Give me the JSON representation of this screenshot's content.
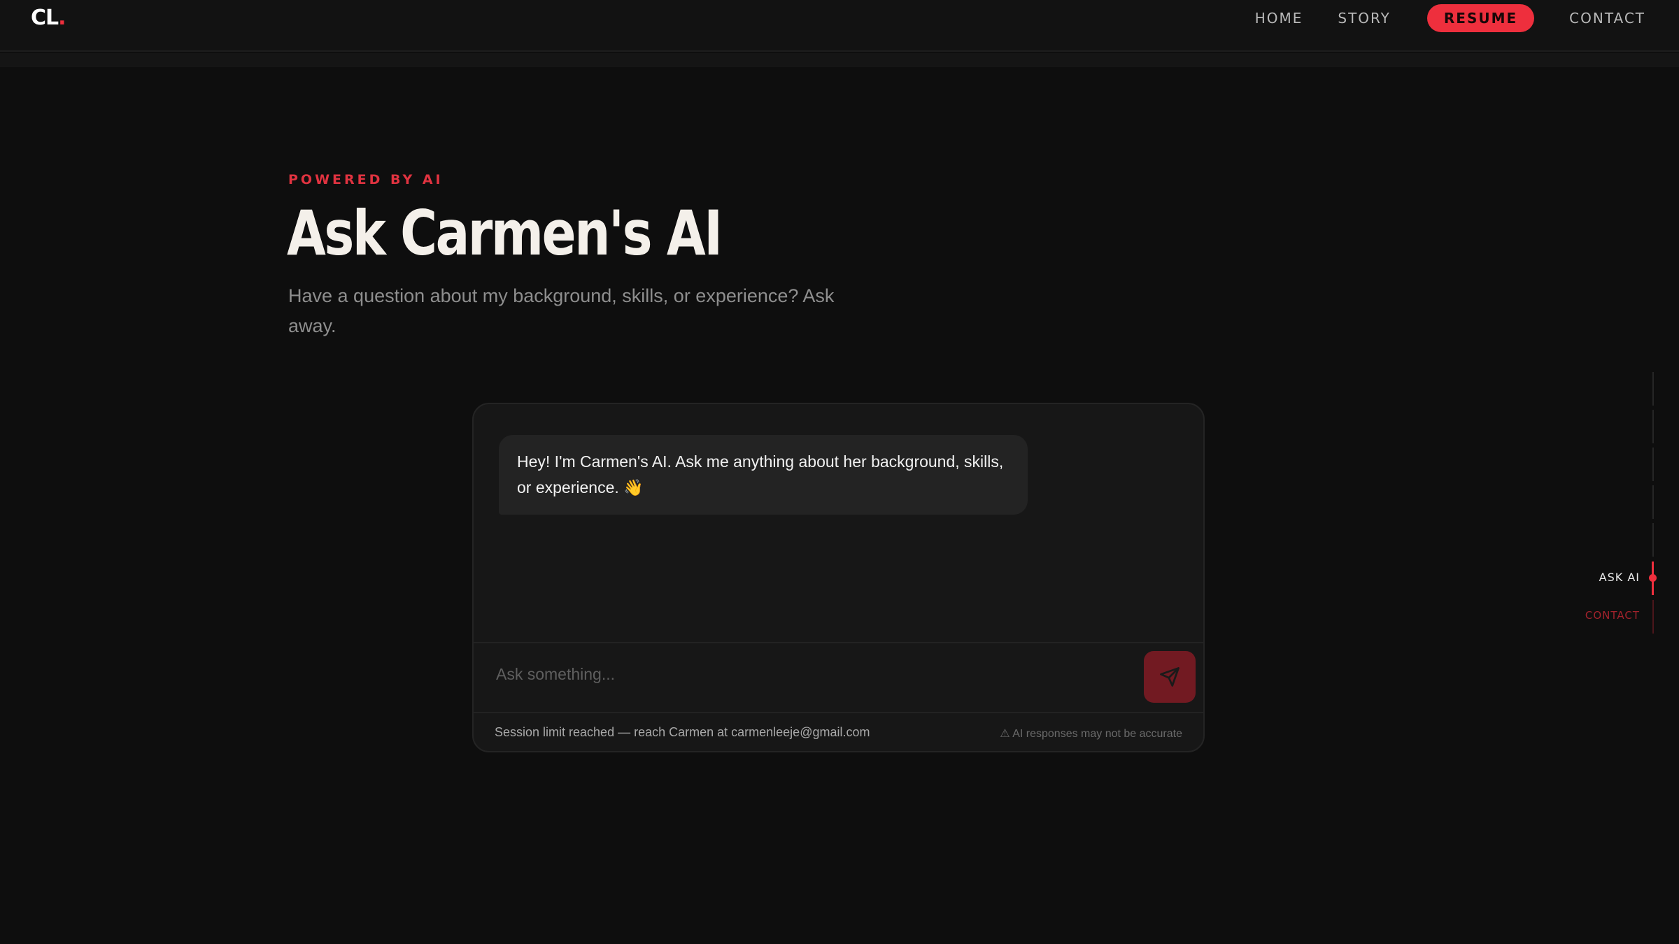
{
  "header": {
    "logo_text": "CL",
    "logo_dot": ".",
    "nav": {
      "home": "HOME",
      "story": "STORY",
      "resume": "RESUME",
      "contact": "CONTACT"
    }
  },
  "hero": {
    "eyebrow": "POWERED BY AI",
    "title": "Ask Carmen's AI",
    "subtitle": "Have a question about my background, skills, or experience? Ask away."
  },
  "chat": {
    "greeting": "Hey! I'm Carmen's AI. Ask me anything about her background, skills, or experience. 👋",
    "input_placeholder": "Ask something...",
    "input_value": "",
    "send_icon": "send-icon",
    "session_notice": "Session limit reached — reach Carmen at carmenleeje@gmail.com",
    "disclaimer": "⚠ AI responses may not be accurate"
  },
  "side_nav": {
    "active_label": "ASK AI",
    "next_label": "CONTACT"
  },
  "colors": {
    "accent": "#ee2f3d",
    "background": "#0e0e0e",
    "card": "#171717",
    "send_button": "#721a22"
  }
}
